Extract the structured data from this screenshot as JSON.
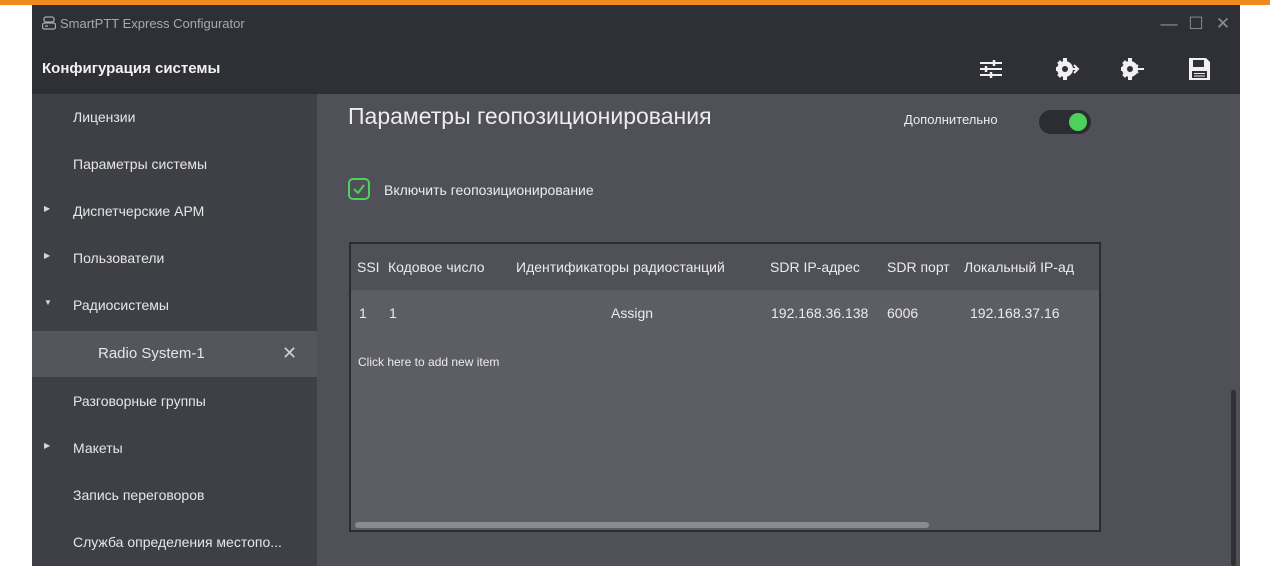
{
  "window": {
    "title": "SmartPTT Express Configurator",
    "controls": [
      "—",
      "☐",
      "✕"
    ]
  },
  "header": {
    "title": "Конфигурация системы",
    "tools": [
      "settings-sliders-icon",
      "import-icon",
      "export-icon",
      "save-icon"
    ]
  },
  "sidebar": {
    "items": [
      {
        "label": "Лицензии",
        "expandable": false
      },
      {
        "label": "Параметры системы",
        "expandable": false
      },
      {
        "label": "Диспетчерские АРМ",
        "expandable": true,
        "expanded": false
      },
      {
        "label": "Пользователи",
        "expandable": true,
        "expanded": false
      },
      {
        "label": "Радиосистемы",
        "expandable": true,
        "expanded": true
      },
      {
        "label": "Radio System-1",
        "child": true,
        "close": "✕"
      },
      {
        "label": "Разговорные группы",
        "expandable": false
      },
      {
        "label": "Макеты",
        "expandable": true,
        "expanded": false
      },
      {
        "label": "Запись переговоров",
        "expandable": false
      },
      {
        "label": "Служба определения местопо...",
        "expandable": false
      }
    ]
  },
  "main": {
    "title": "Параметры геопозиционирования",
    "advanced_label": "Дополнительно",
    "advanced_on": true,
    "enable_checkbox_label": "Включить геопозиционирование",
    "enable_checked": true,
    "grid": {
      "columns": [
        "SSI",
        "Кодовое число",
        "Идентификаторы радиостанций",
        "SDR IP-адрес",
        "SDR порт",
        "Локальный IP-ад"
      ],
      "rows": [
        [
          "1",
          "1",
          "Assign",
          "192.168.36.138",
          "6006",
          "192.168.37.16"
        ]
      ],
      "add_item": "Click here to add new item"
    }
  },
  "colors": {
    "accent": "#f08a1c",
    "toggle_on": "#4cd15a",
    "titlebar": "#2f3036",
    "sidebar": "#3f4046",
    "content": "#4f5058"
  }
}
